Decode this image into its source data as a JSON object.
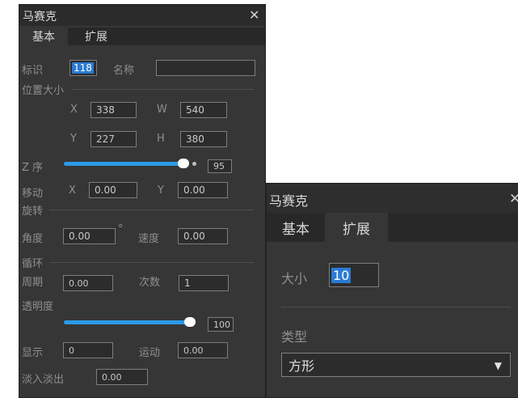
{
  "left": {
    "title": "马赛克",
    "tabs": [
      "基本",
      "扩展"
    ],
    "id_label": "标识",
    "id_value": "118",
    "name_label": "名称",
    "name_value": "",
    "pos_size_label": "位置大小",
    "x_label": "X",
    "x_value": "338",
    "w_label": "W",
    "w_value": "540",
    "y_label": "Y",
    "y_value": "227",
    "h_label": "H",
    "h_value": "380",
    "z_label": "Z 序",
    "z_value": "95",
    "move_label": "移动",
    "move_x_label": "X",
    "move_x_value": "0.00",
    "move_y_label": "Y",
    "move_y_value": "0.00",
    "rotate_label": "旋转",
    "angle_label": "角度",
    "angle_value": "0.00",
    "angle_unit": "°",
    "speed_label": "速度",
    "speed_value": "0.00",
    "loop_label": "循环",
    "period_label": "周期",
    "period_value": "0.00",
    "count_label": "次数",
    "count_value": "1",
    "opacity_label": "透明度",
    "opacity_value": "100",
    "show_label": "显示",
    "show_value": "0",
    "motion_label": "运动",
    "motion_value": "0.00",
    "fade_label": "淡入淡出",
    "fade_value": "0.00"
  },
  "right": {
    "title": "马赛克",
    "tabs": [
      "基本",
      "扩展"
    ],
    "size_label": "大小",
    "size_value": "10",
    "type_label": "类型",
    "type_value": "方形"
  },
  "colors": {
    "accent": "#2b9ae8",
    "selection": "#2a7bd4",
    "panel_bg": "#363636"
  },
  "icons": [
    "close-icon",
    "chevron-down-icon"
  ]
}
